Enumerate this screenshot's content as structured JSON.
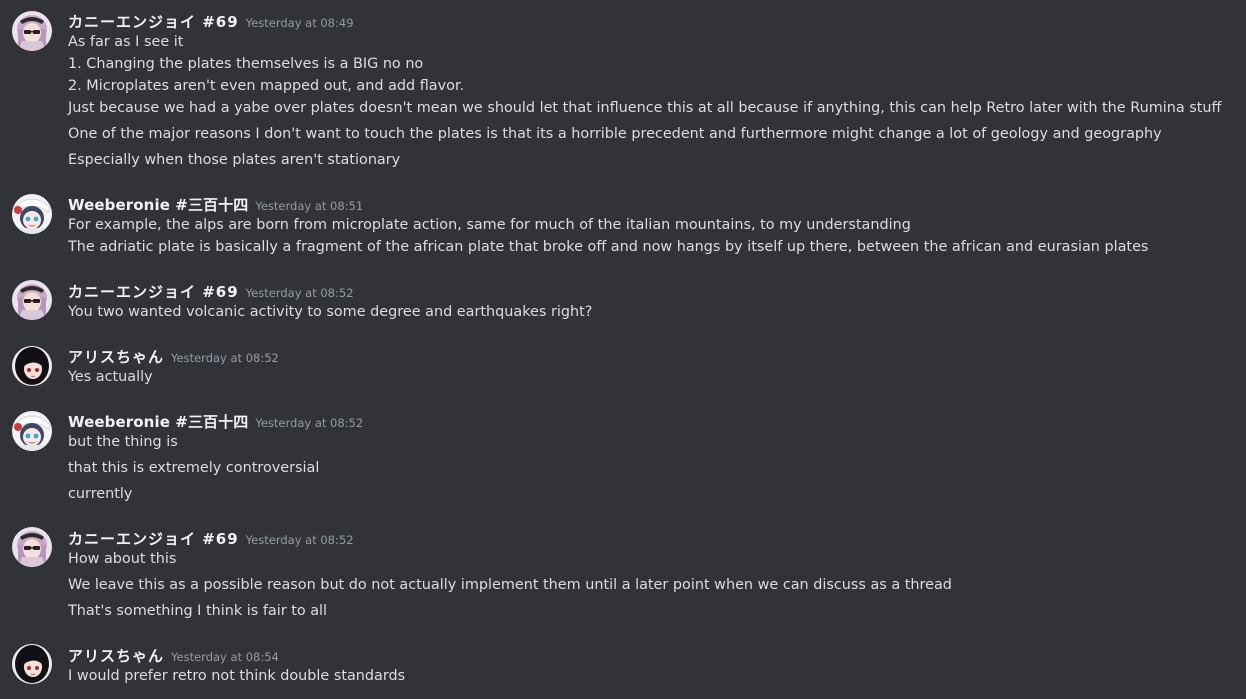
{
  "colors": {
    "background": "#313338",
    "text": "#dbdee1",
    "username": "#f2f3f5",
    "timestamp": "#949ba4"
  },
  "messages": [
    {
      "author": "カニーエンジョイ #69",
      "avatar": "pink-hair-sunglasses-avatar",
      "timestamp": "Yesterday at 08:49",
      "lines": [
        "As far as I see it",
        "1. Changing the plates themselves is a BIG no no",
        "2. Microplates aren't even mapped out, and add flavor.",
        "Just because we had a yabe over plates doesn't mean we should let that influence this at all because if anything, this can help Retro later with the Rumina stuff",
        "One of the major reasons I don't want to touch the plates is that its a horrible precedent and furthermore might change a lot of geology and geography",
        "Especially when those plates aren't stationary"
      ]
    },
    {
      "author": "Weeberonie #三百十四",
      "avatar": "anime-girl-white-hat-avatar",
      "timestamp": "Yesterday at 08:51",
      "lines": [
        "For example, the alps are born from microplate action, same for much of the italian mountains, to my understanding",
        "The adriatic plate is basically a fragment of the african plate that broke off and now hangs by itself up there, between the african and eurasian plates"
      ]
    },
    {
      "author": "カニーエンジョイ #69",
      "avatar": "pink-hair-sunglasses-avatar",
      "timestamp": "Yesterday at 08:52",
      "lines": [
        "You two wanted volcanic activity to some degree and earthquakes right?"
      ]
    },
    {
      "author": "アリスちゃん",
      "avatar": "dark-hair-girl-avatar",
      "timestamp": "Yesterday at 08:52",
      "lines": [
        "Yes actually"
      ]
    },
    {
      "author": "Weeberonie #三百十四",
      "avatar": "anime-girl-white-hat-avatar",
      "timestamp": "Yesterday at 08:52",
      "lines": [
        "but the thing is",
        "that this is extremely controversial",
        "currently"
      ]
    },
    {
      "author": "カニーエンジョイ #69",
      "avatar": "pink-hair-sunglasses-avatar",
      "timestamp": "Yesterday at 08:52",
      "lines": [
        "How about this",
        "We leave this as a possible reason but do not actually implement them until a later point when we can discuss as a thread",
        "That's something I think is fair to all"
      ]
    },
    {
      "author": "アリスちゃん",
      "avatar": "dark-hair-girl-avatar",
      "timestamp": "Yesterday at 08:54",
      "lines": [
        "I would prefer retro not think double standards"
      ]
    }
  ]
}
